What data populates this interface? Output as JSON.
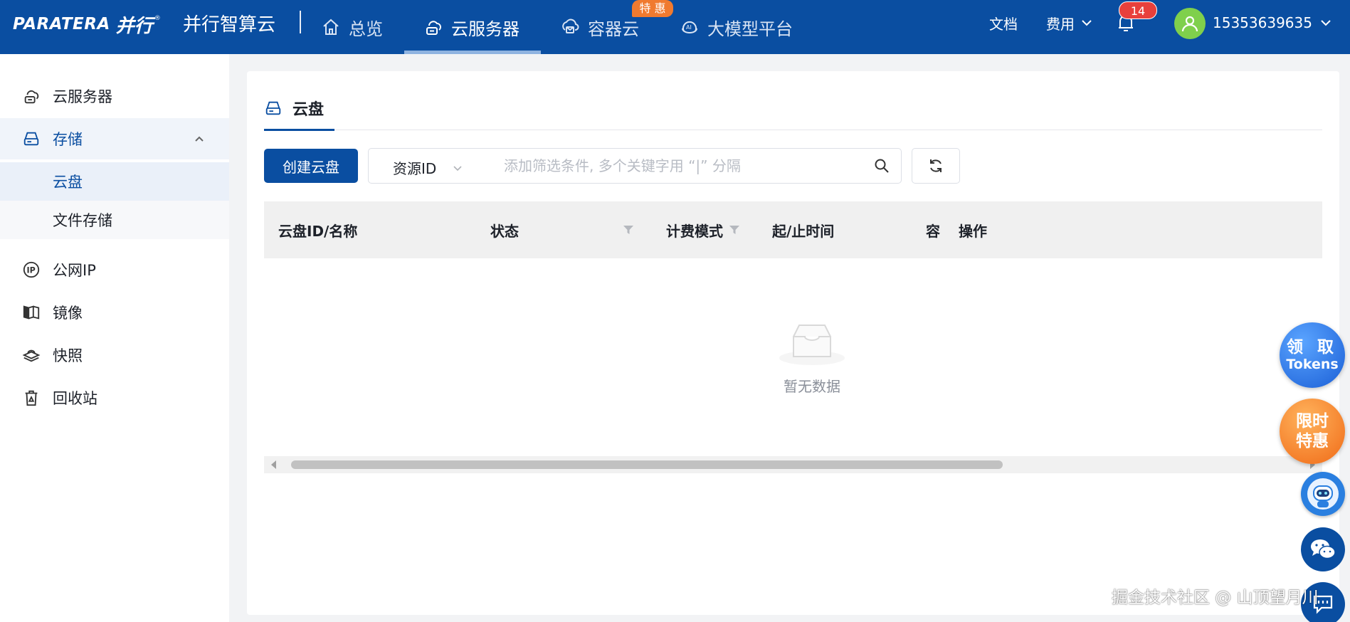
{
  "header": {
    "logo_text": "PARATERA",
    "logo_cn": "并行",
    "brand": "并行智算云",
    "nav": [
      {
        "label": "总览",
        "icon": "home-icon",
        "active": false
      },
      {
        "label": "云服务器",
        "icon": "cloud-server-icon",
        "active": true
      },
      {
        "label": "容器云",
        "icon": "container-cloud-icon",
        "active": false,
        "badge": "特 惠"
      },
      {
        "label": "大模型平台",
        "icon": "ai-icon",
        "active": false
      }
    ],
    "docs_label": "文档",
    "billing_label": "费用",
    "notification_count": "14",
    "username": "15353639635"
  },
  "sidebar": {
    "items": [
      {
        "label": "云服务器",
        "icon": "cloud-server-icon"
      },
      {
        "label": "存储",
        "icon": "storage-icon",
        "expanded": true,
        "children": [
          {
            "label": "云盘",
            "active": true
          },
          {
            "label": "文件存储",
            "active": false
          }
        ]
      },
      {
        "label": "公网IP",
        "icon": "ip-icon"
      },
      {
        "label": "镜像",
        "icon": "image-icon"
      },
      {
        "label": "快照",
        "icon": "snapshot-icon"
      },
      {
        "label": "回收站",
        "icon": "recycle-bin-icon"
      }
    ]
  },
  "main": {
    "title": "云盘",
    "create_button": "创建云盘",
    "filter": {
      "selected_field": "资源ID",
      "placeholder": "添加筛选条件, 多个关键字用 “|” 分隔",
      "value": ""
    },
    "table": {
      "columns": [
        "云盘ID/名称",
        "状态",
        "计费模式",
        "起/止时间",
        "容",
        "操作"
      ],
      "rows": [],
      "empty_text": "暂无数据"
    }
  },
  "floating": {
    "tokens_line1": "领 取",
    "tokens_line2": "Tokens",
    "sale_line1": "限时",
    "sale_line2": "特惠"
  },
  "watermark": "掘金技术社区 @ 山顶望月川",
  "colors": {
    "primary": "#0a4ea1",
    "badge_orange": "#f07a2f",
    "badge_red": "#e8403c",
    "avatar_green": "#7fd04c"
  }
}
